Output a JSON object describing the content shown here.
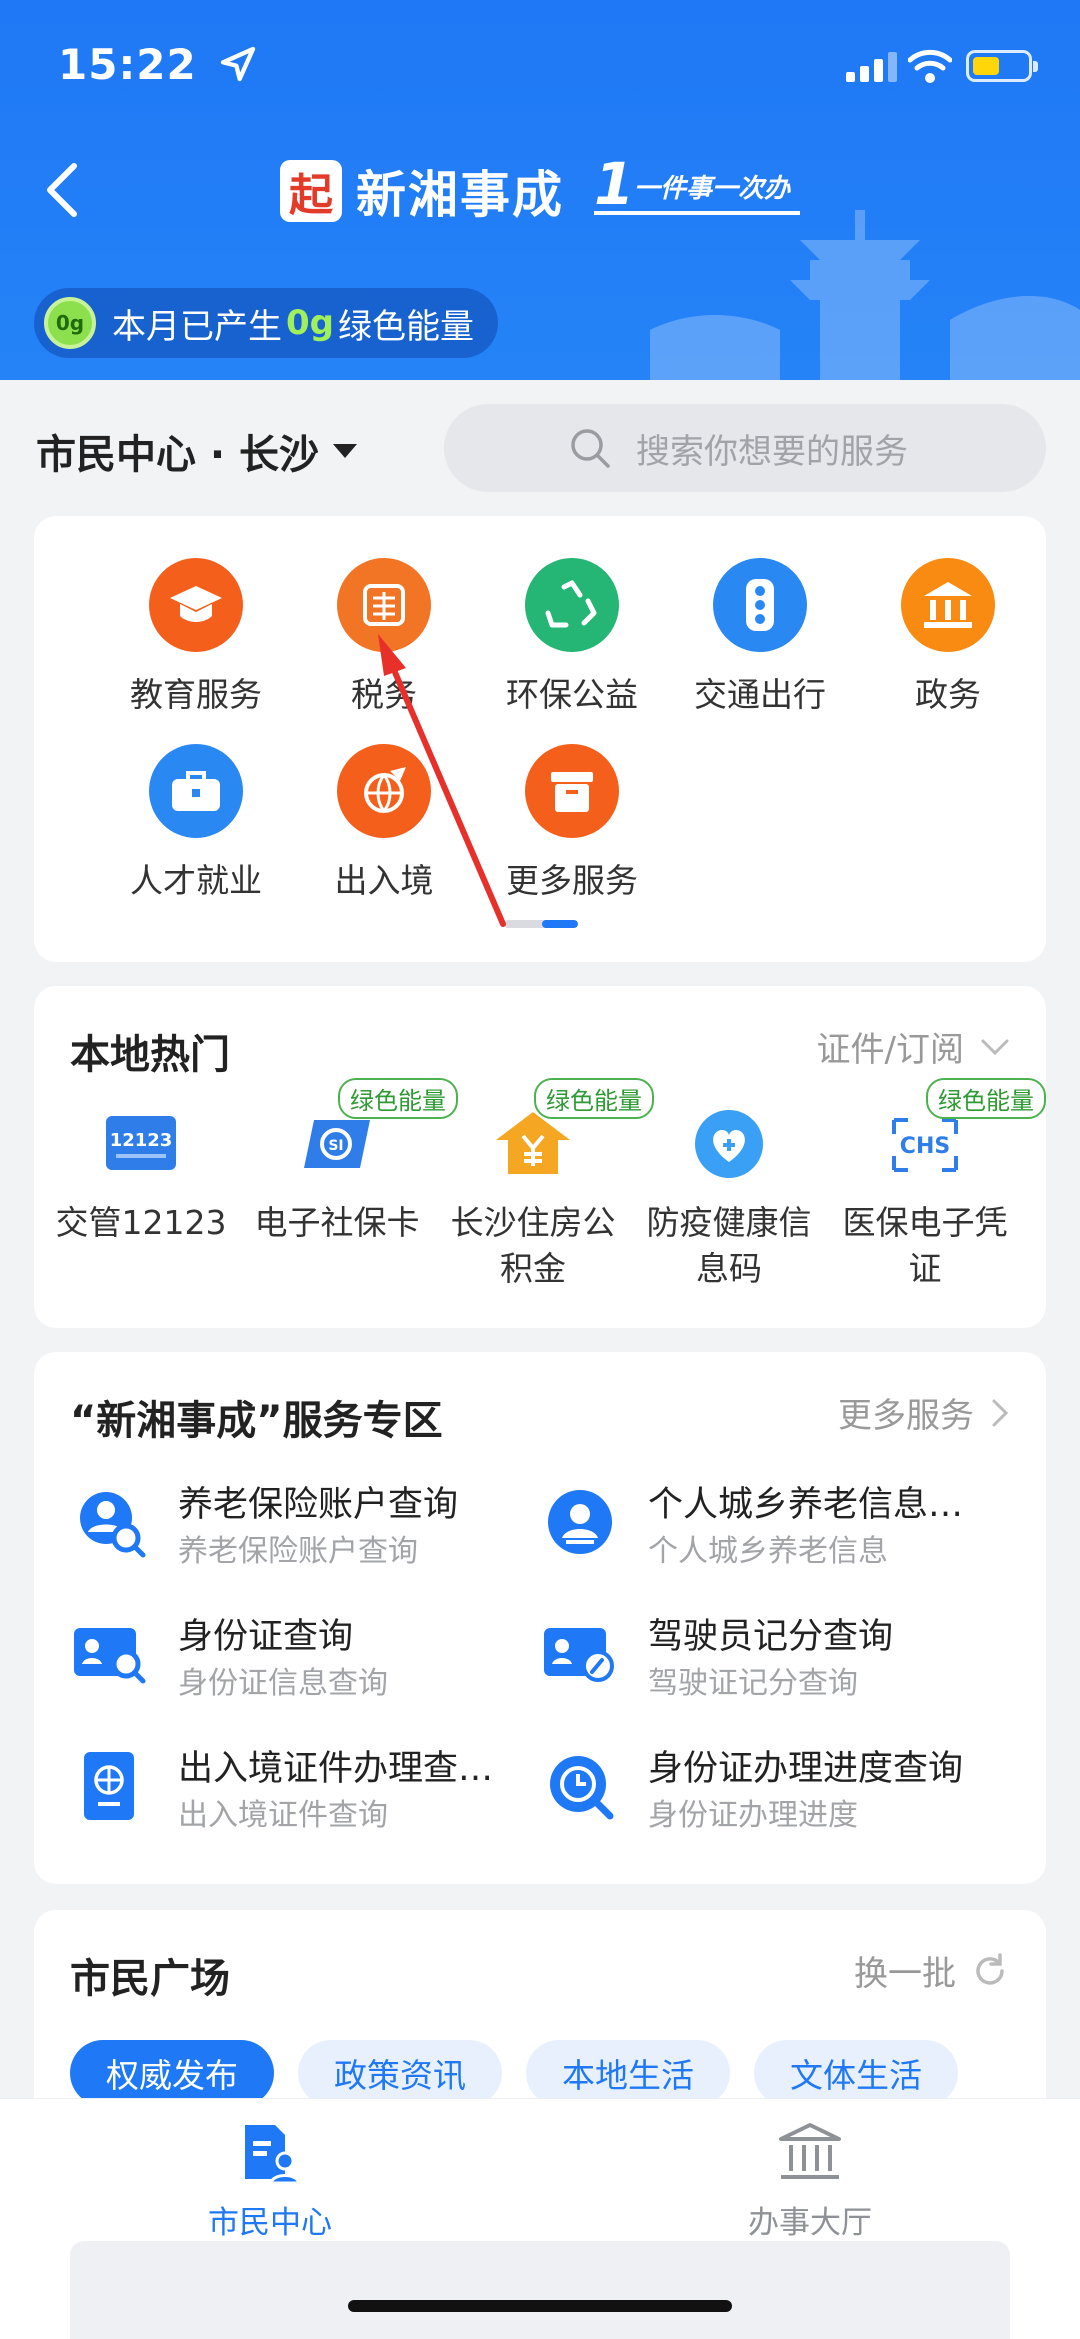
{
  "status_bar": {
    "time": "15:22"
  },
  "header": {
    "brand_logo_char": "起",
    "brand_name": "新湘事成",
    "slogan": "一件事一次办",
    "energy_badge": "0g",
    "energy_prefix": "本月已产生",
    "energy_amount": "0g",
    "energy_suffix": "绿色能量"
  },
  "location": {
    "city": "市民中心 · 长沙"
  },
  "search": {
    "placeholder": "搜索你想要的服务"
  },
  "services": [
    {
      "label": "教育服务",
      "icon": "graduation-cap-icon",
      "color": "#f4601c"
    },
    {
      "label": "税务",
      "icon": "tax-icon",
      "color": "#f27425"
    },
    {
      "label": "环保公益",
      "icon": "recycle-icon",
      "color": "#25b574"
    },
    {
      "label": "交通出行",
      "icon": "traffic-light-icon",
      "color": "#2a88f2"
    },
    {
      "label": "政务",
      "icon": "government-building-icon",
      "color": "#f98a12"
    },
    {
      "label": "人才就业",
      "icon": "briefcase-icon",
      "color": "#2a88f2"
    },
    {
      "label": "出入境",
      "icon": "airplane-globe-icon",
      "color": "#f4601c"
    },
    {
      "label": "更多服务",
      "icon": "more-box-icon",
      "color": "#f4601c"
    }
  ],
  "local_hot": {
    "title": "本地热门",
    "more": "证件/订阅",
    "items": [
      {
        "label": "交管12123",
        "icon": "traffic-12123-icon",
        "tag": ""
      },
      {
        "label": "电子社保卡",
        "icon": "social-security-card-icon",
        "tag": "绿色能量"
      },
      {
        "label": "长沙住房公积金",
        "icon": "housing-fund-icon",
        "tag": "绿色能量"
      },
      {
        "label": "防疫健康信息码",
        "icon": "health-code-icon",
        "tag": ""
      },
      {
        "label": "医保电子凭证",
        "icon": "medical-insurance-icon",
        "tag": "绿色能量"
      }
    ]
  },
  "zone": {
    "title": "“新湘事成”服务专区",
    "more": "更多服务",
    "items": [
      {
        "title": "养老保险账户查询",
        "subtitle": "养老保险账户查询"
      },
      {
        "title": "个人城乡养老信息…",
        "subtitle": "个人城乡养老信息"
      },
      {
        "title": "身份证查询",
        "subtitle": "身份证信息查询"
      },
      {
        "title": "驾驶员记分查询",
        "subtitle": "驾驶证记分查询"
      },
      {
        "title": "出入境证件办理查…",
        "subtitle": "出入境证件查询"
      },
      {
        "title": "身份证办理进度查询",
        "subtitle": "身份证办理进度"
      }
    ]
  },
  "plaza": {
    "title": "市民广场",
    "refresh": "换一批",
    "tabs": [
      "权威发布",
      "政策资讯",
      "本地生活",
      "文体生活"
    ]
  },
  "tabbar": {
    "tabs": [
      {
        "label": "市民中心",
        "active": true
      },
      {
        "label": "办事大厅",
        "active": false
      }
    ]
  },
  "colors": {
    "primary": "#1f78f5",
    "green_tag": "#2f9a34"
  }
}
